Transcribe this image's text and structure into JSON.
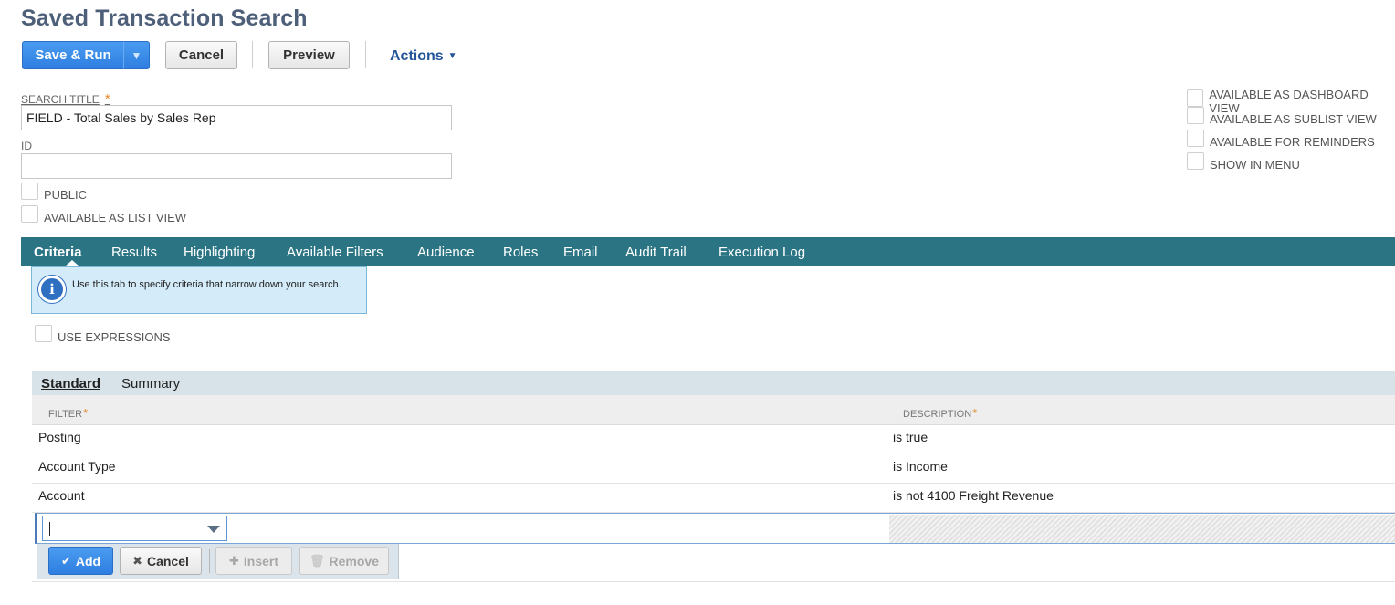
{
  "page": {
    "title": "Saved Transaction Search"
  },
  "toolbar": {
    "save_run": "Save & Run",
    "save_run_arrow": "▼",
    "cancel": "Cancel",
    "preview": "Preview",
    "actions": "Actions",
    "actions_caret": "▼"
  },
  "form": {
    "search_title_label": "SEARCH TITLE",
    "required_mark": "*",
    "search_title_value": "FIELD - Total Sales by Sales Rep",
    "id_label": "ID",
    "id_value": "",
    "public_label": "PUBLIC",
    "available_list_view_label": "AVAILABLE AS LIST VIEW",
    "right_options": [
      "AVAILABLE AS DASHBOARD VIEW",
      "AVAILABLE AS SUBLIST VIEW",
      "AVAILABLE FOR REMINDERS",
      "SHOW IN MENU"
    ]
  },
  "tabs": [
    "Criteria",
    "Results",
    "Highlighting",
    "Available Filters",
    "Audience",
    "Roles",
    "Email",
    "Audit Trail",
    "Execution Log"
  ],
  "info": {
    "icon": "i",
    "text": "Use this tab to specify criteria that narrow down your search."
  },
  "use_expressions_label": "USE EXPRESSIONS",
  "subtabs": [
    "Standard",
    "Summary"
  ],
  "grid": {
    "columns": [
      "FILTER",
      "DESCRIPTION"
    ],
    "required_mark": "*",
    "rows": [
      {
        "filter": "Posting",
        "description": "is true"
      },
      {
        "filter": "Account Type",
        "description": "is Income"
      },
      {
        "filter": "Account",
        "description": "is not 4100 Freight Revenue"
      }
    ],
    "new_filter_value": ""
  },
  "row_buttons": {
    "add": "Add",
    "cancel": "Cancel",
    "insert": "Insert",
    "remove": "Remove",
    "add_icon": "✔",
    "cancel_icon": "✖",
    "insert_icon": "✚",
    "remove_icon": "🗑"
  },
  "colors": {
    "tab_bar": "#2a7484",
    "primary": "#2e7fe1",
    "title": "#4d5f79",
    "link": "#255599"
  }
}
